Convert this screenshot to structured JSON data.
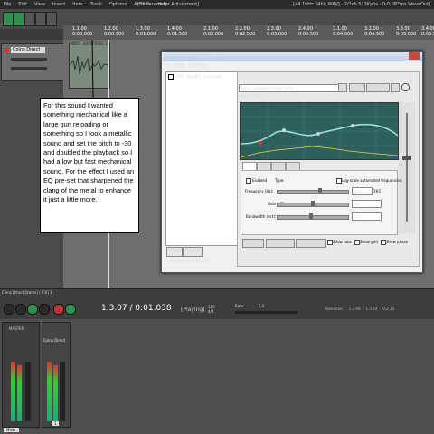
{
  "app": {
    "menus": [
      "File",
      "Edit",
      "View",
      "Insert",
      "Item",
      "Track",
      "Options",
      "Actions",
      "Help"
    ],
    "window_title": "[FX Parameter Adjustment]",
    "status": "[44.1kHz 24bit WAV] - 2/2ch 512Kpbs - 0:0.087ms WaveOut]"
  },
  "ruler": {
    "marks": [
      {
        "bar": "1.1.00",
        "time": "0:00.000"
      },
      {
        "bar": "1.2.00",
        "time": "0:00.500"
      },
      {
        "bar": "1.3.00",
        "time": "0:01.000"
      },
      {
        "bar": "1.4.00",
        "time": "0:01.500"
      },
      {
        "bar": "2.1.00",
        "time": "0:02.000"
      },
      {
        "bar": "2.2.00",
        "time": "0:02.500"
      },
      {
        "bar": "2.3.00",
        "time": "0:03.000"
      },
      {
        "bar": "2.4.00",
        "time": "0:03.500"
      },
      {
        "bar": "3.1.00",
        "time": "0:04.000"
      },
      {
        "bar": "3.2.00",
        "time": "0:04.500"
      },
      {
        "bar": "3.3.00",
        "time": "0:05.000"
      },
      {
        "bar": "3.4.00",
        "time": "0:05.500"
      }
    ]
  },
  "track": {
    "name": "Coins Direct",
    "item_label": "Pitch: -30.00 Rate: 2"
  },
  "fx": {
    "title": "FX: Track 1 \"Coins Direct\"",
    "menus": [
      "FX",
      "Edit",
      "Options"
    ],
    "chain_item": "VST: ReaEQ (Cockos)",
    "add": "Add",
    "remove": "Remove",
    "cpu": "0.1%/0.1% CPU 0/0 spls",
    "preset": "stock - Intimate female vocal",
    "buttons": {
      "plus": "+",
      "param": "Param",
      "io": "2 in 2 out",
      "ui": "UI"
    },
    "plugin_version": "ReaEQ v0.75",
    "tabs": [
      "1",
      "2",
      "3",
      "4"
    ],
    "enabled_label": "Enabled",
    "type_label": "Type:",
    "log_label": "Log-scale automated frequencies",
    "params": [
      {
        "label": "Frequency (Hz):",
        "value": "80.0",
        "extra": "D#2"
      },
      {
        "label": "Gain (dB):",
        "value": "0.0"
      },
      {
        "label": "Bandwidth (oct):",
        "value": "2.50"
      }
    ],
    "bottom": {
      "add_band": "Add band",
      "remove_band": "Remove band",
      "reset": "Reset defaults",
      "tabs": "Show tabs",
      "grid": "Show grid",
      "phase": "Show phase"
    },
    "gain_label": "Gain",
    "gain_value": "0.0"
  },
  "callout": "For this sound I wanted something mechanical like a large gun reloading or something so I took a metallic sound and set the pitch to -30 and doubled the playback so I had a low but fast mechanical sound. For the effect I used an EQ pre-set that sharpened the clang of the metal to enhance it just a little more.",
  "transport": {
    "track_label": "Coins Direct [items] / [FX] 1",
    "time": "1.3.07 / 0:01.038",
    "state": "[Playing]",
    "bpm": "120",
    "sig": "4/4",
    "rate": "Rate:",
    "rate_value": "1.0",
    "selection": "Selection:",
    "sel_values": [
      "1.2.09",
      "1.3.24",
      "0.2.14"
    ]
  },
  "mixer": {
    "master": "MASTER",
    "strip": "Coins Direct",
    "strip_num": "1",
    "tab": "Mixer"
  }
}
